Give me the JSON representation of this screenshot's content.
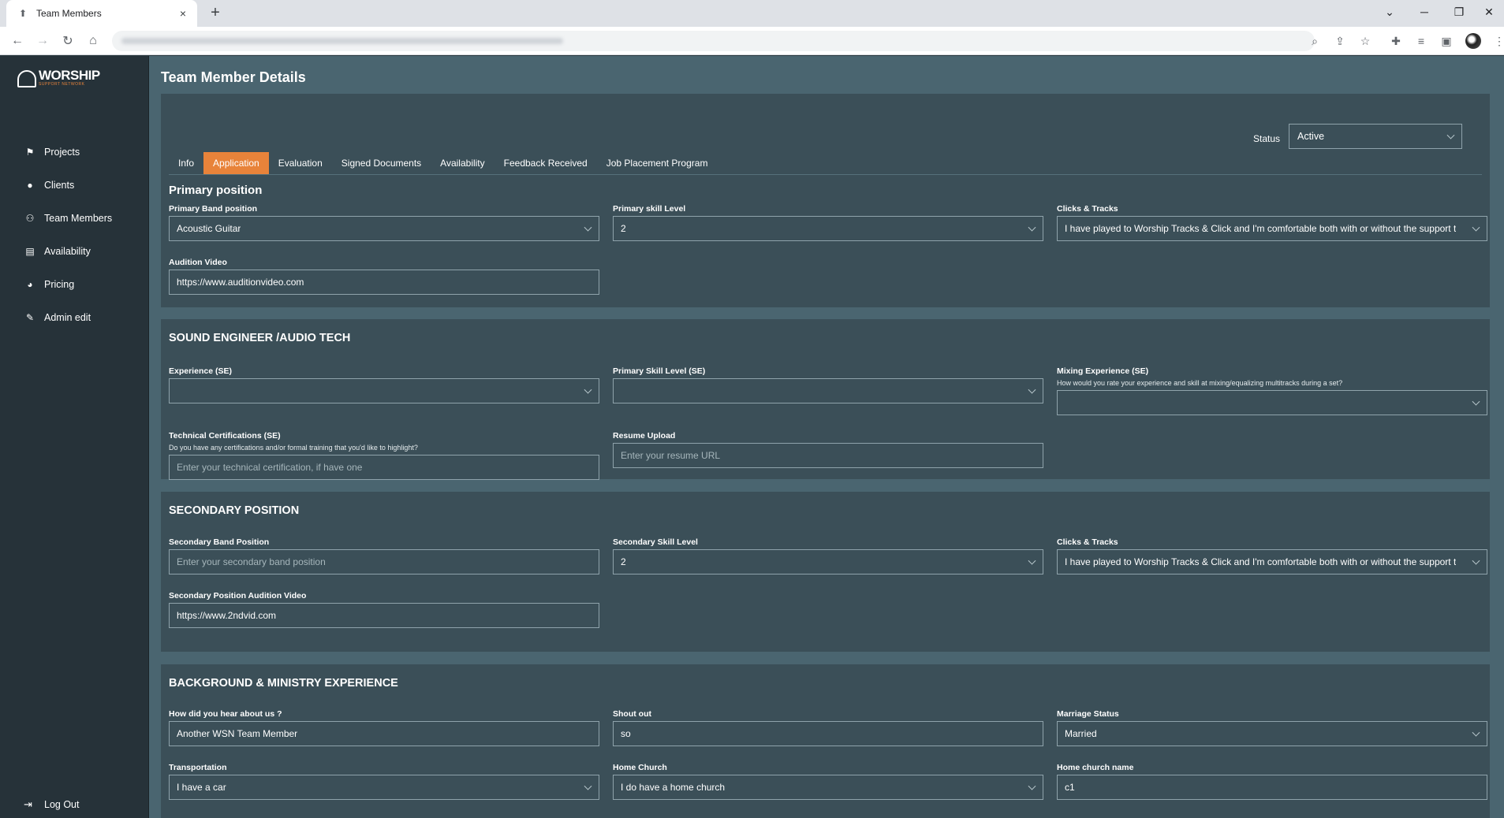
{
  "browser": {
    "tab_title": "Team Members",
    "tab_close": "×",
    "new_tab": "+"
  },
  "sidebar": {
    "logo_main": "WORSHIP",
    "logo_sub": "SUPPORT NETWORK",
    "items": [
      {
        "label": "Projects",
        "icon": "projects-icon"
      },
      {
        "label": "Clients",
        "icon": "person-icon"
      },
      {
        "label": "Team Members",
        "icon": "people-icon"
      },
      {
        "label": "Availability",
        "icon": "clipboard-icon"
      },
      {
        "label": "Pricing",
        "icon": "pie-chart-icon"
      },
      {
        "label": "Admin edit",
        "icon": "pencil-icon"
      }
    ],
    "logout_label": "Log Out"
  },
  "page": {
    "title": "Team Member Details",
    "status_label": "Status",
    "status_value": "Active",
    "tabs": [
      "Info",
      "Application",
      "Evaluation",
      "Signed Documents",
      "Availability",
      "Feedback Received",
      "Job Placement Program"
    ],
    "active_tab": "Application"
  },
  "primary": {
    "title": "Primary position",
    "band_position_label": "Primary Band position",
    "band_position_value": "Acoustic Guitar",
    "skill_level_label": "Primary skill Level",
    "skill_level_value": "2",
    "clicks_label": "Clicks & Tracks",
    "clicks_value": "I have played to Worship Tracks & Click and I'm comfortable both with or without the support t",
    "audition_label": "Audition Video",
    "audition_value": "https://www.auditionvideo.com"
  },
  "sound": {
    "title": "SOUND ENGINEER /AUDIO TECH",
    "experience_label": "Experience (SE)",
    "skill_label": "Primary Skill Level (SE)",
    "mixing_label": "Mixing Experience (SE)",
    "mixing_help": "How would you rate your experience and skill at mixing/equalizing multitracks during a set?",
    "cert_label": "Technical Certifications (SE)",
    "cert_help": "Do you have any certifications and/or formal training that you'd like to highlight?",
    "cert_placeholder": "Enter your technical certification, if have one",
    "resume_label": "Resume Upload",
    "resume_placeholder": "Enter your resume URL"
  },
  "secondary": {
    "title": "SECONDARY POSITION",
    "band_label": "Secondary Band Position",
    "band_placeholder": "Enter your secondary band position",
    "skill_label": "Secondary Skill Level",
    "skill_value": "2",
    "clicks_label": "Clicks & Tracks",
    "clicks_value": "I have played to Worship Tracks & Click and I'm comfortable both with or without the support t",
    "video_label": "Secondary Position Audition Video",
    "video_value": "https://www.2ndvid.com"
  },
  "background": {
    "title": "BACKGROUND & MINISTRY EXPERIENCE",
    "hear_label": "How did you hear about us ?",
    "hear_value": "Another WSN Team Member",
    "shout_label": "Shout out",
    "shout_value": "so",
    "marriage_label": "Marriage Status",
    "marriage_value": "Married",
    "transport_label": "Transportation",
    "transport_value": "I have a car",
    "church_label": "Home Church",
    "church_value": "I do have a home church",
    "church_name_label": "Home church name",
    "church_name_value": "c1"
  },
  "colors": {
    "accent": "#e8833a",
    "sidebar_bg": "#263239",
    "main_bg": "#4a6570",
    "card_bg": "#3b4f58"
  }
}
